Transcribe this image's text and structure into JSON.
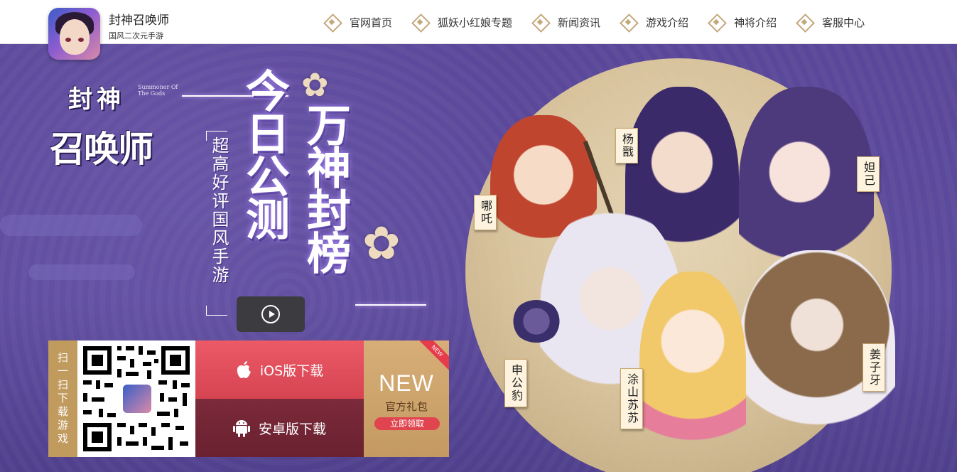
{
  "header": {
    "app_title": "封神召唤师",
    "app_subtitle": "国风二次元手游",
    "nav": [
      {
        "label": "官网首页"
      },
      {
        "label": "狐妖小红娘专题"
      },
      {
        "label": "新闻资讯"
      },
      {
        "label": "游戏介绍"
      },
      {
        "label": "神将介绍"
      },
      {
        "label": "客服中心"
      }
    ]
  },
  "hero": {
    "logo_line1": "封神",
    "logo_line2": "召唤师",
    "logo_en": "Summoner Of The Gods",
    "headline_left": "今日公测",
    "headline_right": "万神封榜",
    "tagline": "超高好评国风手游",
    "characters": [
      {
        "name": "杨戬"
      },
      {
        "name": "妲己"
      },
      {
        "name": "哪吒"
      },
      {
        "name": "申公豹"
      },
      {
        "name": "涂山苏苏"
      },
      {
        "name": "姜子牙"
      }
    ]
  },
  "download": {
    "scan_label": "扫一扫下载游戏",
    "ios_label": "iOS版下载",
    "android_label": "安卓版下载",
    "gift_badge": "NEW",
    "gift_title": "NEW",
    "gift_text": "官方礼包",
    "gift_button": "立即领取"
  },
  "colors": {
    "accent_gold": "#c19a5e",
    "ios_red": "#e04f5d",
    "android_wine": "#722535",
    "hero_purple": "#5d4b9d"
  }
}
